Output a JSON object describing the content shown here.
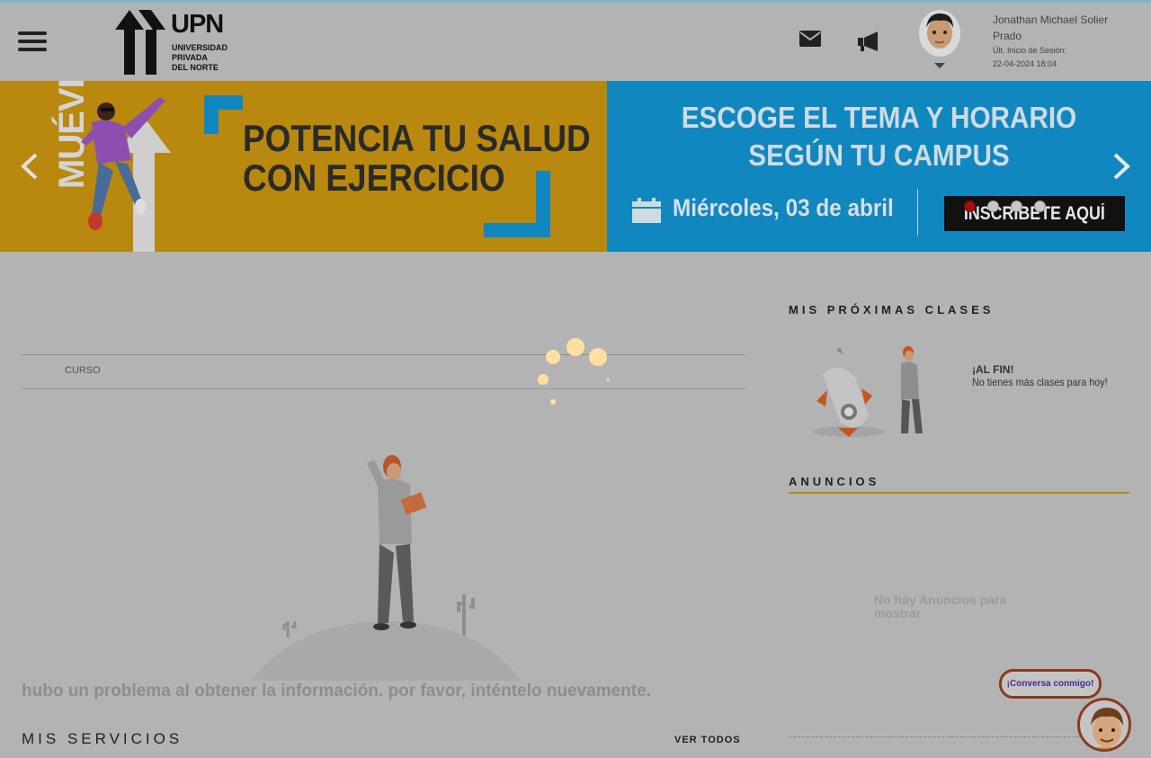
{
  "header": {
    "logo_big": "UPN",
    "logo_small_1": "UNIVERSIDAD",
    "logo_small_2": "PRIVADA",
    "logo_small_3": "DEL NORTE",
    "user_name": "Jonathan Michael Solier Prado",
    "last_login_label": "Últ. Inicio de Sesión:",
    "last_login_value": "22-04-2024 18:04",
    "icons": [
      "menu-icon",
      "mail-icon",
      "megaphone-icon",
      "chevron-down-icon"
    ]
  },
  "banner": {
    "left_vertical": "MUÉVETE",
    "left_line1": "POTENCIA TU SALUD",
    "left_line2": "CON EJERCICIO",
    "right_line1": "ESCOGE EL TEMA Y HORARIO",
    "right_line2": "SEGÚN TU CAMPUS",
    "date": "Miércoles, 03 de abril",
    "cta": "INSCRÍBETE AQUÍ",
    "slide_count": 4,
    "active_slide": 1,
    "colors": {
      "left_bg": "#b8880f",
      "right_bg": "#1187bf"
    }
  },
  "main": {
    "course_column": "CURSO",
    "error_message": "hubo un problema al obtener la información. por favor, inténtelo nuevamente.",
    "services_title": "MIS SERVICIOS",
    "see_all": "VER TODOS"
  },
  "sidebar": {
    "next_classes_title": "MIS PRÓXIMAS CLASES",
    "alfin": "¡AL FIN!",
    "no_classes": "No tienes más clases para hoy!",
    "announcements_title": "ANUNCIOS",
    "no_announcements": "No hay Anuncios para mostrar"
  },
  "chat": {
    "label": "¡Conversa conmigo!"
  }
}
